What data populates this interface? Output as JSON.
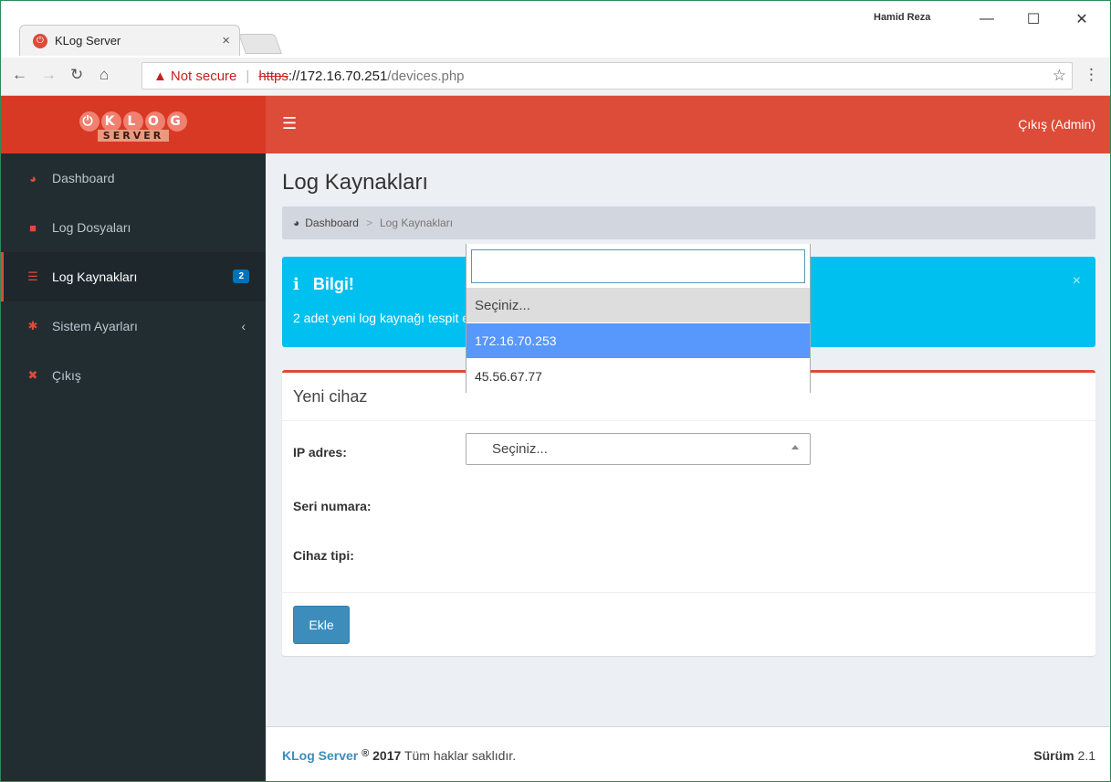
{
  "browser": {
    "tab_title": "KLog Server",
    "tab_close": "×",
    "window_user": "Hamid Reza",
    "minimize": "—",
    "maximize": "☐",
    "close": "✕",
    "not_secure": "Not secure",
    "url_scheme": "https",
    "url_sep": "://",
    "url_host": "172.16.70.251",
    "url_path": "/devices.php"
  },
  "app": {
    "logo_text": "KLOG",
    "logo_sub": "SERVER",
    "logout_top": "Çıkış (Admin)"
  },
  "sidebar": {
    "items": [
      {
        "label": "Dashboard",
        "icon": "dashboard-icon"
      },
      {
        "label": "Log Dosyaları",
        "icon": "archive-icon"
      },
      {
        "label": "Log Kaynakları",
        "icon": "server-icon",
        "badge": "2",
        "active": true
      },
      {
        "label": "Sistem Ayarları",
        "icon": "gear-icon",
        "chevron": "‹"
      },
      {
        "label": "Çıkış",
        "icon": "close-icon"
      }
    ]
  },
  "page": {
    "title": "Log Kaynakları",
    "breadcrumb_home": "Dashboard",
    "breadcrumb_sep": ">",
    "breadcrumb_current": "Log Kaynakları"
  },
  "callout": {
    "icon": "i",
    "title": "Bilgi!",
    "text": "2 adet yeni log kaynağı tespit edildi.",
    "close": "×"
  },
  "form": {
    "box_title": "Yeni cihaz",
    "ip_label": "IP adres:",
    "serial_label": "Seri numara:",
    "type_label": "Cihaz tipi:",
    "select_value": "Seçiniz...",
    "submit_label": "Ekle"
  },
  "dropdown": {
    "search_value": "",
    "options": [
      "Seçiniz...",
      "172.16.70.253",
      "45.56.67.77"
    ],
    "highlighted_index": 1
  },
  "footer": {
    "brand": "KLog Server",
    "reg": "®",
    "year": "2017",
    "rights": "Tüm haklar saklıdır.",
    "version_label": "Sürüm",
    "version": "2.1"
  },
  "colors": {
    "header_red": "#dd4b39",
    "sidebar_dark": "#222d32",
    "info_cyan": "#00c0ef",
    "primary_blue": "#3c8dbc",
    "select_highlight": "#5897fb"
  }
}
